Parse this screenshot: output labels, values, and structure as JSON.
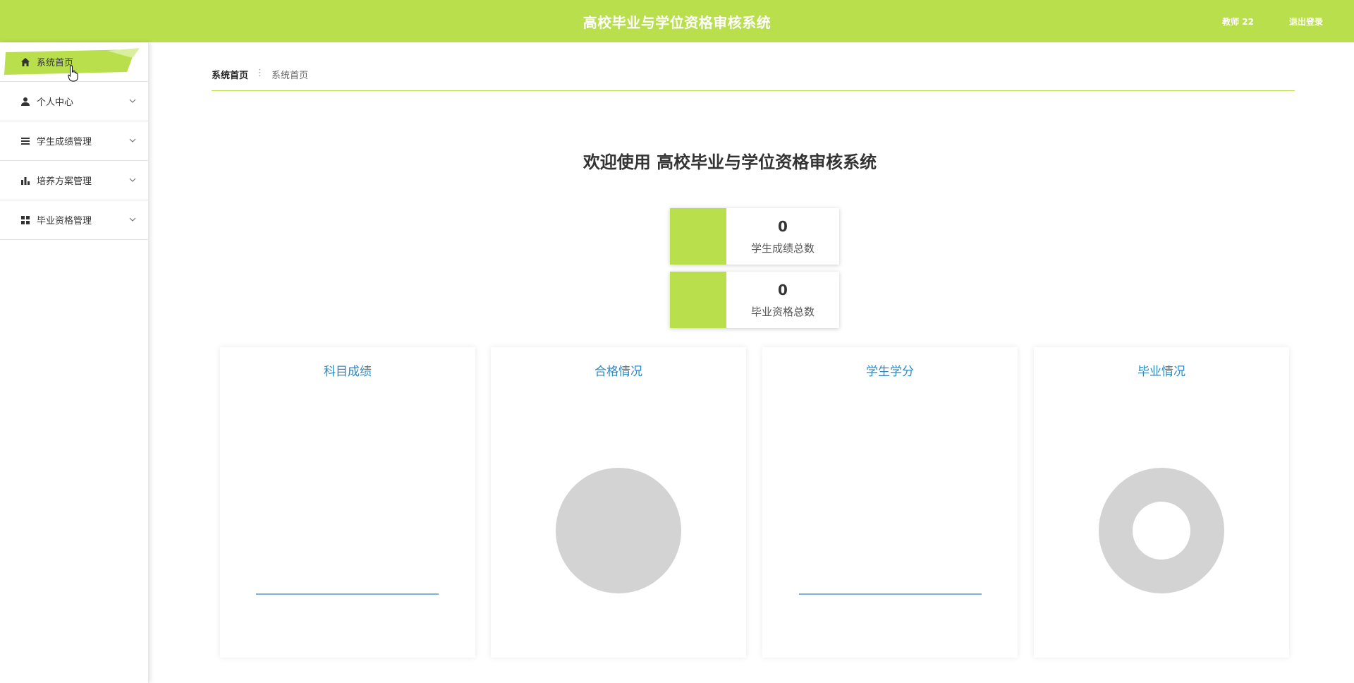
{
  "header": {
    "title": "高校毕业与学位资格审核系统",
    "user": "教师 22",
    "logout": "退出登录",
    "bg_color": "#b9df4d"
  },
  "sidebar": {
    "items": [
      {
        "label": "系统首页",
        "icon": "home-icon",
        "active": true
      },
      {
        "label": "个人中心",
        "icon": "user-icon"
      },
      {
        "label": "学生成绩管理",
        "icon": "list-icon"
      },
      {
        "label": "培养方案管理",
        "icon": "bar-chart-icon"
      },
      {
        "label": "毕业资格管理",
        "icon": "grid-icon"
      }
    ]
  },
  "breadcrumb": {
    "root": "系统首页",
    "current": "系统首页"
  },
  "welcome": "欢迎使用 高校毕业与学位资格审核系统",
  "stats": [
    {
      "value": "0",
      "caption": "学生成绩总数"
    },
    {
      "value": "0",
      "caption": "毕业资格总数"
    }
  ],
  "charts": [
    {
      "title": "科目成绩",
      "type": "bar"
    },
    {
      "title": "合格情况",
      "type": "pie"
    },
    {
      "title": "学生学分",
      "type": "bar"
    },
    {
      "title": "毕业情况",
      "type": "donut"
    }
  ],
  "colors": {
    "accent": "#b9df4d",
    "chart_title": "#2e89c0",
    "empty_pie": "#d3d3d3"
  }
}
